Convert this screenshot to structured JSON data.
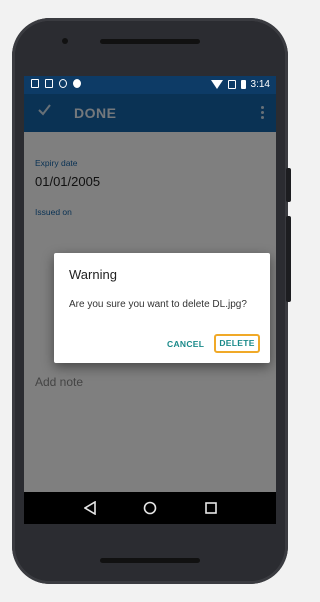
{
  "statusbar": {
    "time": "3:14"
  },
  "appbar": {
    "action_label": "DONE"
  },
  "form": {
    "expiry_label": "Expiry date",
    "expiry_value": "01/01/2005",
    "issued_label": "Issued on",
    "note_placeholder": "Add note"
  },
  "dialog": {
    "title": "Warning",
    "message": "Are you sure you want to delete DL.jpg?",
    "cancel_label": "CANCEL",
    "delete_label": "DELETE"
  },
  "colors": {
    "statusbar": "#0d3b66",
    "appbar": "#1565a8",
    "accent_text": "#1a8a8a",
    "focus_outline": "#f0a928"
  },
  "icons": [
    "image-icon",
    "sim-icon",
    "location-icon",
    "android-icon",
    "wifi-icon",
    "signal-icon",
    "battery-icon",
    "check-icon",
    "overflow-menu-icon",
    "back-nav-icon",
    "home-nav-icon",
    "recents-nav-icon"
  ]
}
